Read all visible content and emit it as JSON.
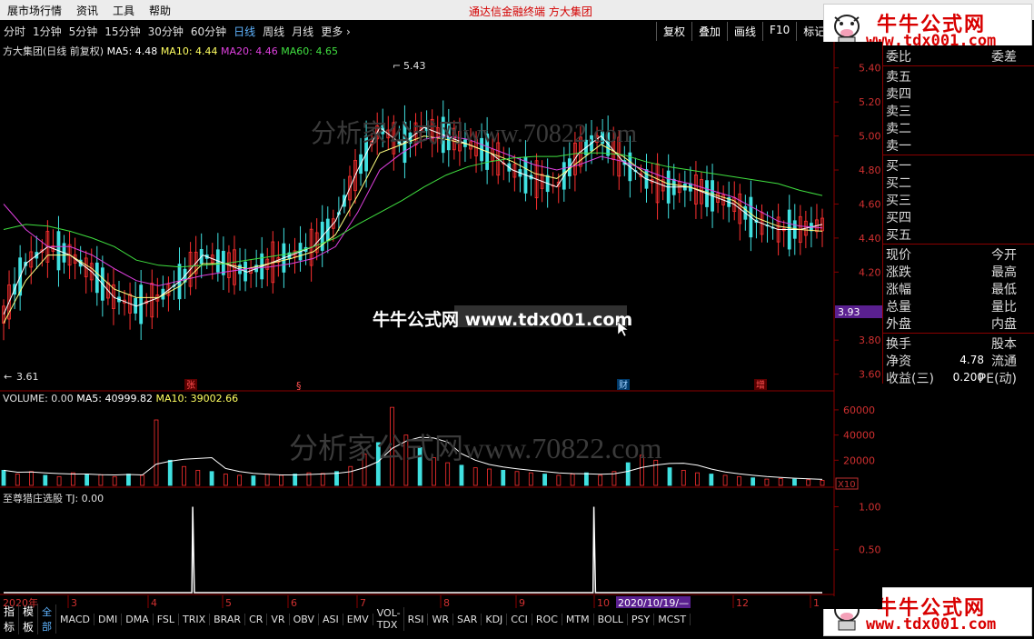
{
  "menubar": {
    "items": [
      "展市场行情",
      "资讯",
      "工具",
      "帮助"
    ],
    "title": "通达信金融终端    方大集团"
  },
  "toolbar": {
    "periods": [
      "分时",
      "1分钟",
      "5分钟",
      "15分钟",
      "30分钟",
      "60分钟",
      "日线",
      "周线",
      "月线",
      "更多 ›"
    ],
    "active": "日线",
    "right_buttons": [
      "复权",
      "叠加",
      "画线",
      "F10",
      "标记"
    ]
  },
  "logo": {
    "name": "牛牛公式网",
    "url": "www.tdx001.com"
  },
  "chart_header": {
    "name": "方大集团(日线 前复权)",
    "ma5": "MA5: 4.48",
    "ma10": "MA10: 4.44",
    "ma20": "MA20: 4.46",
    "ma60": "MA60: 4.65"
  },
  "annotations": {
    "high": "5.43",
    "low": "3.61",
    "price_tag": "3.93"
  },
  "markers": [
    "张",
    "§",
    "财",
    "增"
  ],
  "watermarks": {
    "main": "分析家公式网www.70822.com",
    "overlay": "牛牛公式网 www.tdx001.com"
  },
  "volume_header": {
    "label": "VOLUME: 0.00",
    "ma5": "MA5: 40999.82",
    "ma10": "MA10: 39002.66"
  },
  "volume_unit": "X10",
  "indicator_header": "至尊猎庄选股  TJ: 0.00",
  "dates": [
    "2020年",
    "3",
    "4",
    "5",
    "6",
    "7",
    "8",
    "9",
    "10",
    "2020/10/19/—",
    "12",
    "1"
  ],
  "right_panel": {
    "top": [
      [
        "委比",
        "委差"
      ]
    ],
    "sell": [
      "卖五",
      "卖四",
      "卖三",
      "卖二",
      "卖一"
    ],
    "buy": [
      "买一",
      "买二",
      "买三",
      "买四",
      "买五"
    ],
    "stats": [
      [
        "现价",
        "",
        "今开"
      ],
      [
        "涨跌",
        "",
        "最高"
      ],
      [
        "涨幅",
        "",
        "最低"
      ],
      [
        "总量",
        "",
        "量比"
      ],
      [
        "外盘",
        "",
        "内盘"
      ]
    ],
    "fin": [
      [
        "换手",
        "",
        "股本"
      ],
      [
        "净资",
        "4.78",
        "流通"
      ],
      [
        "收益(三)",
        "0.200",
        "PE(动)"
      ]
    ]
  },
  "ind_tabs": [
    "指标",
    "模板",
    "全部",
    "MACD",
    "DMI",
    "DMA",
    "FSL",
    "TRIX",
    "BRAR",
    "CR",
    "VR",
    "OBV",
    "ASI",
    "EMV",
    "VOL-TDX",
    "RSI",
    "WR",
    "SAR",
    "KDJ",
    "CCI",
    "ROC",
    "MTM",
    "BOLL",
    "PSY",
    "MCST"
  ],
  "ind_tab_active": "全部",
  "chart_data": [
    {
      "type": "line",
      "title": "方大集团(日线 前复权)",
      "ylim": [
        3.55,
        5.5
      ],
      "yticks": [
        "5.40",
        "5.20",
        "5.00",
        "4.80",
        "4.60",
        "4.40",
        "4.20",
        "3.80",
        "3.60"
      ],
      "series": [
        {
          "name": "MA5",
          "color": "#ffffff",
          "values": [
            3.95,
            4.25,
            4.35,
            4.3,
            4.2,
            4.05,
            4.0,
            4.05,
            4.15,
            4.3,
            4.25,
            4.2,
            4.25,
            4.3,
            4.35,
            4.5,
            4.8,
            5.05,
            4.95,
            5.05,
            5.0,
            4.95,
            4.9,
            4.8,
            4.75,
            4.7,
            4.9,
            5.0,
            4.85,
            4.75,
            4.7,
            4.7,
            4.65,
            4.6,
            4.5,
            4.45,
            4.45,
            4.48
          ]
        },
        {
          "name": "MA10",
          "color": "#ffff80",
          "values": [
            3.9,
            4.15,
            4.3,
            4.3,
            4.22,
            4.1,
            4.05,
            4.05,
            4.12,
            4.25,
            4.25,
            4.22,
            4.25,
            4.28,
            4.32,
            4.42,
            4.65,
            4.9,
            4.95,
            5.0,
            4.98,
            4.95,
            4.9,
            4.85,
            4.78,
            4.75,
            4.85,
            4.95,
            4.88,
            4.78,
            4.72,
            4.7,
            4.66,
            4.62,
            4.52,
            4.47,
            4.45,
            4.44
          ]
        },
        {
          "name": "MA20",
          "color": "#e040e0",
          "values": [
            4.6,
            4.45,
            4.35,
            4.35,
            4.3,
            4.22,
            4.15,
            4.12,
            4.15,
            4.18,
            4.2,
            4.22,
            4.23,
            4.25,
            4.28,
            4.35,
            4.55,
            4.8,
            4.9,
            4.98,
            5.0,
            4.98,
            4.93,
            4.88,
            4.83,
            4.8,
            4.83,
            4.88,
            4.85,
            4.8,
            4.75,
            4.72,
            4.68,
            4.64,
            4.57,
            4.5,
            4.47,
            4.46
          ]
        },
        {
          "name": "MA60",
          "color": "#40e040",
          "values": [
            4.45,
            4.48,
            4.47,
            4.44,
            4.4,
            4.35,
            4.27,
            4.24,
            4.23,
            4.24,
            4.25,
            4.27,
            4.29,
            4.31,
            4.35,
            4.4,
            4.48,
            4.55,
            4.62,
            4.7,
            4.77,
            4.82,
            4.85,
            4.87,
            4.88,
            4.88,
            4.9,
            4.9,
            4.89,
            4.85,
            4.82,
            4.8,
            4.78,
            4.76,
            4.74,
            4.72,
            4.68,
            4.65
          ]
        }
      ]
    },
    {
      "type": "bar",
      "title": "VOLUME",
      "ylim": [
        0,
        65000
      ],
      "yticks": [
        "60000",
        "40000",
        "20000"
      ],
      "values": [
        12000,
        9000,
        11000,
        8000,
        7000,
        10000,
        9000,
        8500,
        7000,
        9000,
        8000,
        52000,
        20000,
        15000,
        12000,
        11000,
        9000,
        8000,
        7500,
        9000,
        8000,
        9000,
        10000,
        9500,
        11000,
        15000,
        25000,
        34000,
        62000,
        40000,
        30000,
        22000,
        18000,
        16000,
        14000,
        13000,
        12000,
        11000,
        10000,
        9000,
        8000,
        9000,
        10000,
        8000,
        11000,
        18000,
        24000,
        20000,
        14000,
        12000,
        10000,
        9000,
        8000,
        7000,
        6000,
        5000,
        5500,
        5000,
        4500,
        4000
      ]
    },
    {
      "type": "line",
      "title": "至尊猎庄选股",
      "ylim": [
        0,
        1.1
      ],
      "yticks": [
        "1.00",
        "0.50"
      ],
      "series": [
        {
          "name": "TJ",
          "values": [
            [
              0,
              0
            ],
            [
              0.23,
              0
            ],
            [
              0.231,
              1
            ],
            [
              0.233,
              0
            ],
            [
              0.72,
              0
            ],
            [
              0.721,
              1
            ],
            [
              0.723,
              0
            ],
            [
              1,
              0
            ]
          ]
        }
      ]
    }
  ]
}
